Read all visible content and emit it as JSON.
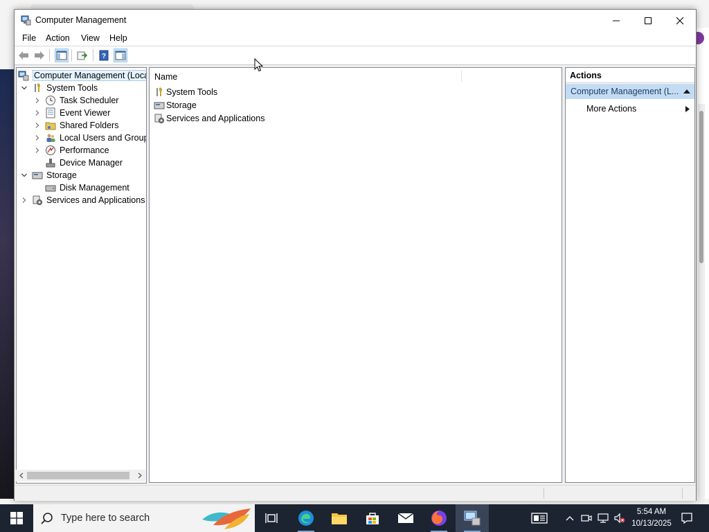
{
  "window": {
    "title": "Computer Management",
    "controls": [
      "minimize",
      "maximize",
      "close"
    ]
  },
  "menu": [
    "File",
    "Action",
    "View",
    "Help"
  ],
  "toolbar": {
    "buttons": [
      "back-arrow-icon",
      "forward-arrow-icon",
      "show-hide-console-tree-icon",
      "export-list-icon",
      "help-icon",
      "show-hide-action-pane-icon"
    ]
  },
  "tree": {
    "items": [
      {
        "label": "Computer Management (Local",
        "level": 0,
        "expander": "none",
        "icon": "computer-management-icon",
        "selected": true
      },
      {
        "label": "System Tools",
        "level": 1,
        "expander": "expanded",
        "icon": "system-tools-icon"
      },
      {
        "label": "Task Scheduler",
        "level": 2,
        "expander": "collapsed",
        "icon": "clock-icon"
      },
      {
        "label": "Event Viewer",
        "level": 2,
        "expander": "collapsed",
        "icon": "event-viewer-icon"
      },
      {
        "label": "Shared Folders",
        "level": 2,
        "expander": "collapsed",
        "icon": "shared-folders-icon"
      },
      {
        "label": "Local Users and Groups",
        "level": 2,
        "expander": "collapsed",
        "icon": "users-icon"
      },
      {
        "label": "Performance",
        "level": 2,
        "expander": "collapsed",
        "icon": "performance-icon"
      },
      {
        "label": "Device Manager",
        "level": 2,
        "expander": "none",
        "icon": "device-manager-icon"
      },
      {
        "label": "Storage",
        "level": 1,
        "expander": "expanded",
        "icon": "storage-icon"
      },
      {
        "label": "Disk Management",
        "level": 2,
        "expander": "none",
        "icon": "disk-management-icon"
      },
      {
        "label": "Services and Applications",
        "level": 1,
        "expander": "collapsed",
        "icon": "services-icon"
      }
    ]
  },
  "list": {
    "column_header": "Name",
    "rows": [
      {
        "label": "System Tools",
        "icon": "system-tools-icon"
      },
      {
        "label": "Storage",
        "icon": "storage-icon"
      },
      {
        "label": "Services and Applications",
        "icon": "services-icon"
      }
    ]
  },
  "actions": {
    "header": "Actions",
    "group_label": "Computer Management (L...",
    "more_actions": "More Actions"
  },
  "taskbar": {
    "search_placeholder": "Type here to search",
    "apps": [
      "task-view-icon",
      "edge-icon",
      "file-explorer-icon",
      "store-icon",
      "mail-icon",
      "firefox-icon",
      "computer-management-icon"
    ],
    "time": "5:54 AM",
    "date": "10/13/2025"
  },
  "colors": {
    "selection": "#e5f3ff",
    "actions_group": "#c4dcf3",
    "taskbar": "#1c2331"
  }
}
